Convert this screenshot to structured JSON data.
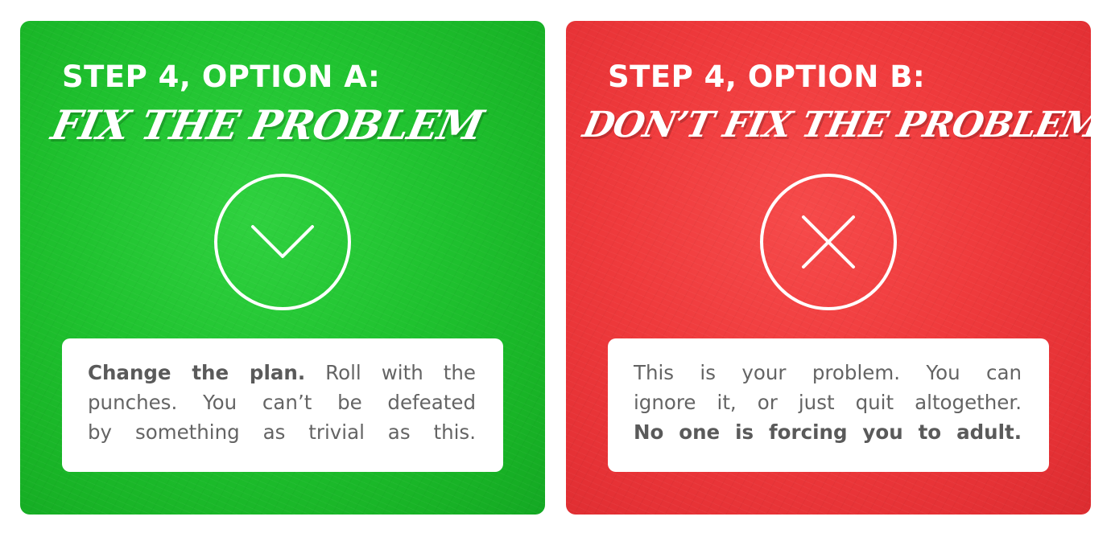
{
  "option_a": {
    "step_title": "STEP 4, OPTION A:",
    "script_title": "Fix the Problem",
    "icon": "check-icon",
    "color": "#1fc22f",
    "message": {
      "bold": "Change the plan.",
      "line1_rest": " Roll with the",
      "line2": "punches. You can’t be defeated",
      "line3": "by something as trivial as this."
    }
  },
  "option_b": {
    "step_title": "STEP 4, OPTION B:",
    "script_title": "Don’t Fix the Problem",
    "icon": "x-icon",
    "color": "#ef3a3c",
    "message": {
      "line1": "This is your problem. You can",
      "line2": "ignore it, or just quit altogether.",
      "bold": "No one is forcing you to adult."
    }
  }
}
